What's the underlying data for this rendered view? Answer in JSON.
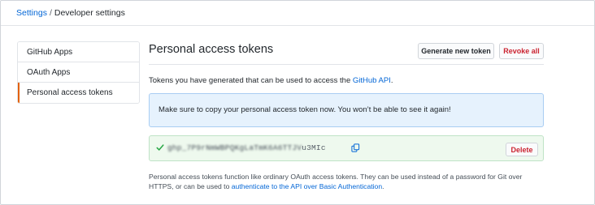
{
  "breadcrumb": {
    "parent": "Settings",
    "separator": "/",
    "current": "Developer settings"
  },
  "sidebar": {
    "items": [
      {
        "label": "GitHub Apps"
      },
      {
        "label": "OAuth Apps"
      },
      {
        "label": "Personal access tokens"
      }
    ],
    "selected_index": 2
  },
  "main": {
    "title": "Personal access tokens",
    "generate_button": "Generate new token",
    "revoke_button": "Revoke all",
    "intro_text": "Tokens you have generated that can be used to access the ",
    "intro_link": "GitHub API",
    "intro_suffix": ".",
    "flash_message": "Make sure to copy your personal access token now. You won’t be able to see it again!",
    "token": {
      "value_visible_suffix": "u3MIc",
      "delete_button": "Delete"
    },
    "footnote_text": "Personal access tokens function like ordinary OAuth access tokens. They can be used instead of a password for Git over HTTPS, or can be used to ",
    "footnote_link": "authenticate to the API over Basic Authentication",
    "footnote_suffix": "."
  },
  "colors": {
    "link": "#0366d6",
    "danger": "#cb2431",
    "selected_accent": "#e36209",
    "flash_bg": "#e6f2fd",
    "success_bg": "#eef9ee",
    "success_icon": "#28a745"
  },
  "icons": {
    "check": "check-icon",
    "copy": "clipboard-icon"
  }
}
